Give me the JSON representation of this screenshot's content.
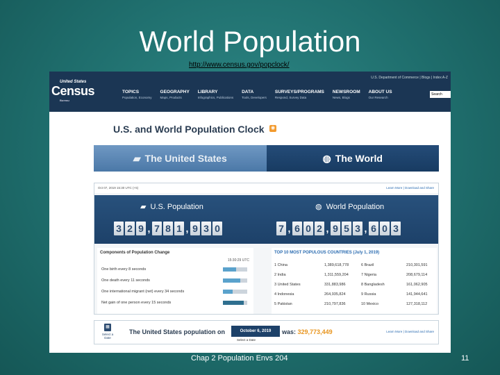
{
  "slide": {
    "title": "World Population",
    "link": "http://www.census.gov/popclock/",
    "footer": "Chap 2 Population Envs 204",
    "page": "11"
  },
  "census": {
    "logo_small": "United States",
    "logo_big": "Census",
    "logo_bureau": "Bureau",
    "utility": "U.S. Department of Commerce | Blogs | Index A-Z",
    "search_placeholder": "Search",
    "nav": [
      {
        "label": "TOPICS",
        "sub": "Population, Economy"
      },
      {
        "label": "GEOGRAPHY",
        "sub": "Maps, Products"
      },
      {
        "label": "LIBRARY",
        "sub": "Infographics, Publications"
      },
      {
        "label": "DATA",
        "sub": "Tools, Developers"
      },
      {
        "label": "SURVEYS/PROGRAMS",
        "sub": "Respond, Survey Data"
      },
      {
        "label": "NEWSROOM",
        "sub": "News, Blogs"
      },
      {
        "label": "ABOUT US",
        "sub": "Our Research"
      }
    ]
  },
  "popclock": {
    "title": "U.S. and World Population Clock",
    "tab_us": "The United States",
    "tab_world": "The World",
    "meta": "Oct 07, 2019 15:30 UTC (+5)",
    "meta_links": "Learn More | Download and Share",
    "us_heading": "U.S. Population",
    "world_heading": "World Population",
    "us_digits": [
      "3",
      "2",
      "9",
      ",",
      "7",
      "8",
      "1",
      ",",
      "9",
      "3",
      "0"
    ],
    "world_digits": [
      "7",
      ",",
      "6",
      "0",
      "2",
      ",",
      "9",
      "5",
      "3",
      ",",
      "6",
      "0",
      "3"
    ],
    "components_heading": "Components of Population Change",
    "components_time": "15:30:29 UTC",
    "components": [
      {
        "label": "One birth every 8 seconds",
        "fill": 0.55
      },
      {
        "label": "One death every 11 seconds",
        "fill": 0.7
      },
      {
        "label": "One international migrant (net) every 34 seconds",
        "fill": 0.4
      },
      {
        "label": "Net gain of one person every 15 seconds",
        "fill": 0.85
      }
    ],
    "top10_heading": "TOP 10 MOST POPULOUS COUNTRIES (July 1, 2019)",
    "top10": [
      {
        "l": "1  China",
        "lv": "1,389,618,778",
        "r": "6  Brazil",
        "rv": "210,301,591"
      },
      {
        "l": "2  India",
        "lv": "1,311,559,204",
        "r": "7  Nigeria",
        "rv": "208,679,114"
      },
      {
        "l": "3  United States",
        "lv": "331,883,986",
        "r": "8  Bangladesh",
        "rv": "161,062,905"
      },
      {
        "l": "4  Indonesia",
        "lv": "264,935,824",
        "r": "9  Russia",
        "rv": "141,944,641"
      },
      {
        "l": "5  Pakistan",
        "lv": "210,797,836",
        "r": "10  Mexico",
        "rv": "127,318,112"
      }
    ],
    "select_date": "Select a Date",
    "us_pop_on": "The United States population on",
    "date": "October 6, 2019",
    "select_date2": "Select a Date",
    "was": "was:",
    "was_value": "329,773,449",
    "bottom_links": "Learn More | Download and Share"
  }
}
